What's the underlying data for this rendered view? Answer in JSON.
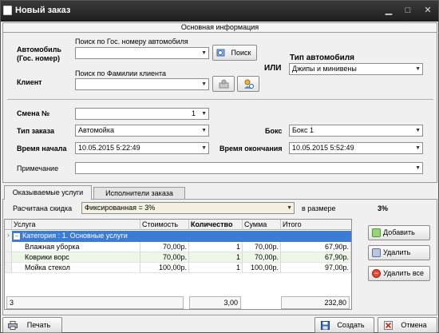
{
  "window": {
    "title": "Новый заказ"
  },
  "section": {
    "title": "Основная информация"
  },
  "car": {
    "label": "Автомобиль (Гос. номер)",
    "hint": "Поиск по Гос. номеру автомобиля",
    "value": "",
    "search_button": "Поиск"
  },
  "client": {
    "label": "Клиент",
    "hint": "Поиск по Фамилии клиента",
    "value": ""
  },
  "or_label": "ИЛИ",
  "car_type": {
    "label": "Тип автомобиля",
    "value": "Джипы и минивены"
  },
  "shift": {
    "label": "Смена №",
    "value": "1"
  },
  "order_type": {
    "label": "Тип заказа",
    "value": "Автомойка"
  },
  "box": {
    "label": "Бокс",
    "value": "Бокс 1"
  },
  "start_time": {
    "label": "Время начала",
    "value": "10.05.2015 5:22:49"
  },
  "end_time": {
    "label": "Время окончания",
    "value": "10.05.2015 5:52:49"
  },
  "note": {
    "label": "Примечание",
    "value": ""
  },
  "tabs": [
    {
      "label": "Оказываемые услуги"
    },
    {
      "label": "Исполнители заказа"
    }
  ],
  "discount": {
    "label": "Расчитана скидка",
    "value": "Фиксированная = 3%",
    "size_label": "в размере",
    "size_value": "3%"
  },
  "grid": {
    "columns": [
      "Услуга",
      "Стоимость",
      "Количество",
      "Сумма",
      "Итого"
    ],
    "group_label": "Категория : 1. Основные услуги",
    "rows": [
      {
        "service": "Влажная уборка",
        "price": "70,00р.",
        "qty": "1",
        "sum": "70,00р.",
        "total": "67,90р."
      },
      {
        "service": "Коврики ворс",
        "price": "70,00р.",
        "qty": "1",
        "sum": "70,00р.",
        "total": "67,90р."
      },
      {
        "service": "Мойка стекол",
        "price": "100,00р.",
        "qty": "1",
        "sum": "100,00р.",
        "total": "97,00р."
      }
    ],
    "footer": {
      "count": "3",
      "qty_total": "3,00",
      "grand_total": "232,80"
    }
  },
  "side_buttons": {
    "add": "Добавить",
    "delete": "Удалить",
    "delete_all": "Удалить все"
  },
  "bottom": {
    "print": "Печать",
    "create": "Создать",
    "cancel": "Отмена"
  },
  "colors": {
    "titlebar": "#2a2a2a",
    "group_row": "#3c7bd6",
    "green_row": "#ecf7e8"
  }
}
